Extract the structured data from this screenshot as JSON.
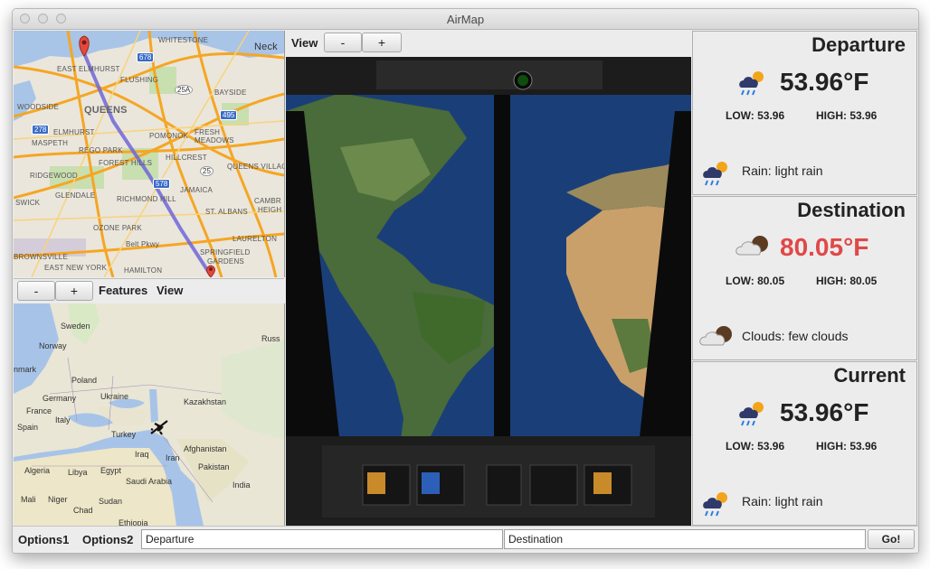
{
  "window": {
    "title": "AirMap"
  },
  "route_map": {
    "labels": {
      "whitestone": "Whitestone",
      "neck": "Neck",
      "east_elmhurst": "East Elmhurst",
      "flushing": "Flushing",
      "queens": "QUEENS",
      "bayside": "Bayside",
      "woodside": "Woodside",
      "elmhurst": "Elmhurst",
      "maspeth": "Maspeth",
      "pomonok": "Pomonok",
      "fresh_meadows": "Fresh Meadows",
      "rego_park": "Rego Park",
      "forest_hills": "Forest Hills",
      "hillcrest": "Hillcrest",
      "ridgewood": "Ridgewood",
      "queens_village": "Queens Village",
      "jamaica": "Jamaica",
      "glendale": "Glendale",
      "richmond_hill": "Richmond Hill",
      "swick": "swick",
      "st_albans": "St. Albans",
      "ozone_park": "Ozone Park",
      "laurelton": "Laurelton",
      "belt_pkwy": "Belt Pkwy",
      "springfield": "Springfield",
      "gardens": "Gardens",
      "brownsville": "Brownsville",
      "east_new_york": "East New York",
      "hamilton": "Hamilton",
      "cambria": "Cambr",
      "heights": "Heigh"
    },
    "shields": {
      "s678": "678",
      "s25a": "25A",
      "s495": "495",
      "s278": "278",
      "s25": "25",
      "s578": "578"
    }
  },
  "map_toolbar": {
    "minus": "-",
    "plus": "+",
    "features": "Features",
    "view": "View"
  },
  "world_map": {
    "labels": {
      "sweden": "Sweden",
      "russia": "Russ",
      "norway": "Norway",
      "denmark": "nmark",
      "poland": "Poland",
      "germany": "Germany",
      "ukraine": "Ukraine",
      "kazakhstan": "Kazakhstan",
      "france": "France",
      "italy": "Italy",
      "spain": "Spain",
      "turkey": "Turkey",
      "afghanistan": "Afghanistan",
      "iraq": "Iraq",
      "iran": "Iran",
      "pakistan": "Pakistan",
      "algeria": "Algeria",
      "libya": "Libya",
      "egypt": "Egypt",
      "saudi_arabia": "Saudi Arabia",
      "india": "India",
      "mali": "Mali",
      "niger": "Niger",
      "sudan": "Sudan",
      "chad": "Chad",
      "ethiopia": "Ethiopia"
    }
  },
  "cockpit_toolbar": {
    "view": "View",
    "minus": "-",
    "plus": "+"
  },
  "weather": {
    "departure": {
      "title": "Departure",
      "temp": "53.96°F",
      "low": "LOW: 53.96",
      "high": "HIGH: 53.96",
      "desc": "Rain: light rain",
      "icon": "rain-sun-icon"
    },
    "destination": {
      "title": "Destination",
      "temp": "80.05°F",
      "low": "LOW: 80.05",
      "high": "HIGH: 80.05",
      "desc": "Clouds: few clouds",
      "icon": "cloud-moon-icon",
      "temp_color": "#e04848"
    },
    "current": {
      "title": "Current",
      "temp": "53.96°F",
      "low": "LOW: 53.96",
      "high": "HIGH: 53.96",
      "desc": "Rain: light rain",
      "icon": "rain-sun-icon"
    }
  },
  "bottom": {
    "options1": "Options1",
    "options2": "Options2",
    "departure_value": "Departure",
    "destination_value": "Destination",
    "go": "Go!"
  }
}
